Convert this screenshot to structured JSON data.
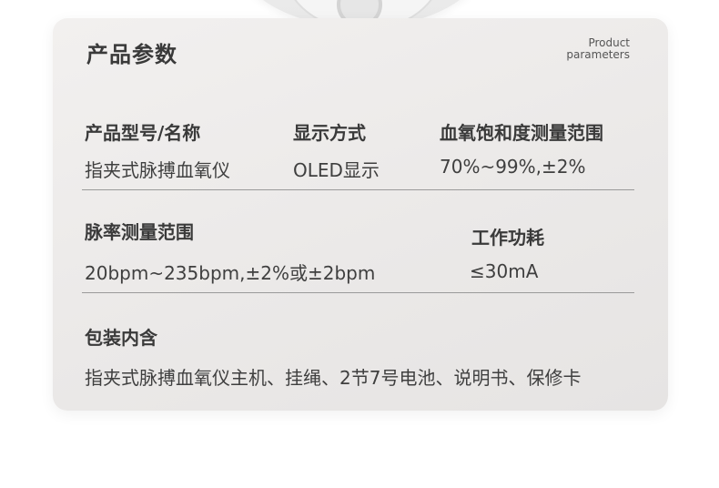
{
  "title": "产品参数",
  "subtitle": {
    "line1": "Product",
    "line2": "parameters"
  },
  "row1": {
    "model": {
      "label": "产品型号/名称",
      "value": "指夹式脉搏血氧仪"
    },
    "display": {
      "label": "显示方式",
      "value": "OLED显示"
    },
    "spo2": {
      "label": "血氧饱和度测量范围",
      "value": "70%~99%,±2%"
    }
  },
  "row2": {
    "pulse": {
      "label": "脉率测量范围",
      "value": "20bpm~235bpm,±2%或±2bpm"
    },
    "power": {
      "label": "工作功耗",
      "value": "≤30mA"
    }
  },
  "row3": {
    "package": {
      "label": "包装内含",
      "value": "指夹式脉搏血氧仪主机、挂绳、2节7号电池、说明书、保修卡"
    }
  },
  "colors": {
    "card": "#ebe9e8",
    "text": "#3a3a3a",
    "divider": "#9a9a9a"
  }
}
